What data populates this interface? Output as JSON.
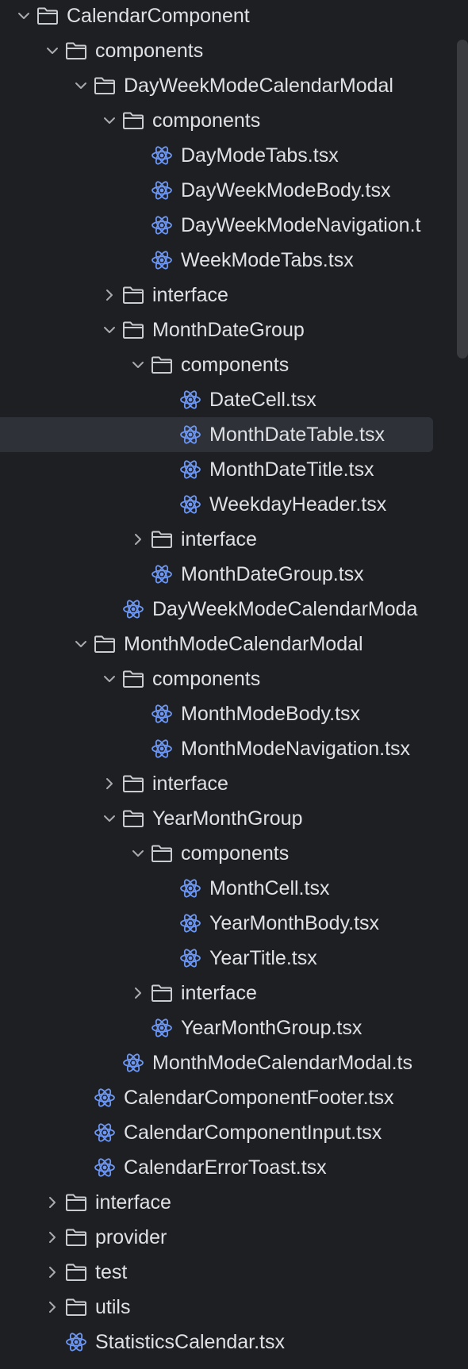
{
  "tree": [
    {
      "label": "CalendarComponent",
      "type": "folder",
      "depth": 0,
      "expanded": true
    },
    {
      "label": "components",
      "type": "folder",
      "depth": 1,
      "expanded": true
    },
    {
      "label": "DayWeekModeCalendarModal",
      "type": "folder",
      "depth": 2,
      "expanded": true
    },
    {
      "label": "components",
      "type": "folder",
      "depth": 3,
      "expanded": true
    },
    {
      "label": "DayModeTabs.tsx",
      "type": "file",
      "depth": 4
    },
    {
      "label": "DayWeekModeBody.tsx",
      "type": "file",
      "depth": 4
    },
    {
      "label": "DayWeekModeNavigation.t",
      "type": "file",
      "depth": 4
    },
    {
      "label": "WeekModeTabs.tsx",
      "type": "file",
      "depth": 4
    },
    {
      "label": "interface",
      "type": "folder",
      "depth": 3,
      "expanded": false
    },
    {
      "label": "MonthDateGroup",
      "type": "folder",
      "depth": 3,
      "expanded": true
    },
    {
      "label": "components",
      "type": "folder",
      "depth": 4,
      "expanded": true
    },
    {
      "label": "DateCell.tsx",
      "type": "file",
      "depth": 5
    },
    {
      "label": "MonthDateTable.tsx",
      "type": "file",
      "depth": 5,
      "selected": true
    },
    {
      "label": "MonthDateTitle.tsx",
      "type": "file",
      "depth": 5
    },
    {
      "label": "WeekdayHeader.tsx",
      "type": "file",
      "depth": 5
    },
    {
      "label": "interface",
      "type": "folder",
      "depth": 4,
      "expanded": false
    },
    {
      "label": "MonthDateGroup.tsx",
      "type": "file",
      "depth": 4
    },
    {
      "label": "DayWeekModeCalendarModa",
      "type": "file",
      "depth": 3
    },
    {
      "label": "MonthModeCalendarModal",
      "type": "folder",
      "depth": 2,
      "expanded": true
    },
    {
      "label": "components",
      "type": "folder",
      "depth": 3,
      "expanded": true
    },
    {
      "label": "MonthModeBody.tsx",
      "type": "file",
      "depth": 4
    },
    {
      "label": "MonthModeNavigation.tsx",
      "type": "file",
      "depth": 4
    },
    {
      "label": "interface",
      "type": "folder",
      "depth": 3,
      "expanded": false
    },
    {
      "label": "YearMonthGroup",
      "type": "folder",
      "depth": 3,
      "expanded": true
    },
    {
      "label": "components",
      "type": "folder",
      "depth": 4,
      "expanded": true
    },
    {
      "label": "MonthCell.tsx",
      "type": "file",
      "depth": 5
    },
    {
      "label": "YearMonthBody.tsx",
      "type": "file",
      "depth": 5
    },
    {
      "label": "YearTitle.tsx",
      "type": "file",
      "depth": 5
    },
    {
      "label": "interface",
      "type": "folder",
      "depth": 4,
      "expanded": false
    },
    {
      "label": "YearMonthGroup.tsx",
      "type": "file",
      "depth": 4
    },
    {
      "label": "MonthModeCalendarModal.ts",
      "type": "file",
      "depth": 3
    },
    {
      "label": "CalendarComponentFooter.tsx",
      "type": "file",
      "depth": 2
    },
    {
      "label": "CalendarComponentInput.tsx",
      "type": "file",
      "depth": 2
    },
    {
      "label": "CalendarErrorToast.tsx",
      "type": "file",
      "depth": 2
    },
    {
      "label": "interface",
      "type": "folder",
      "depth": 1,
      "expanded": false
    },
    {
      "label": "provider",
      "type": "folder",
      "depth": 1,
      "expanded": false
    },
    {
      "label": "test",
      "type": "folder",
      "depth": 1,
      "expanded": false
    },
    {
      "label": "utils",
      "type": "folder",
      "depth": 1,
      "expanded": false
    },
    {
      "label": "StatisticsCalendar.tsx",
      "type": "file",
      "depth": 1
    }
  ],
  "icons": {
    "folder": "folder-icon",
    "file": "react-icon",
    "expanded": "chevron-down-icon",
    "collapsed": "chevron-right-icon"
  },
  "colors": {
    "background": "#1e1f22",
    "text": "#dfe1e5",
    "react_icon": "#6c97f5",
    "selection": "#2e3137",
    "chevron": "#a8abb0"
  }
}
